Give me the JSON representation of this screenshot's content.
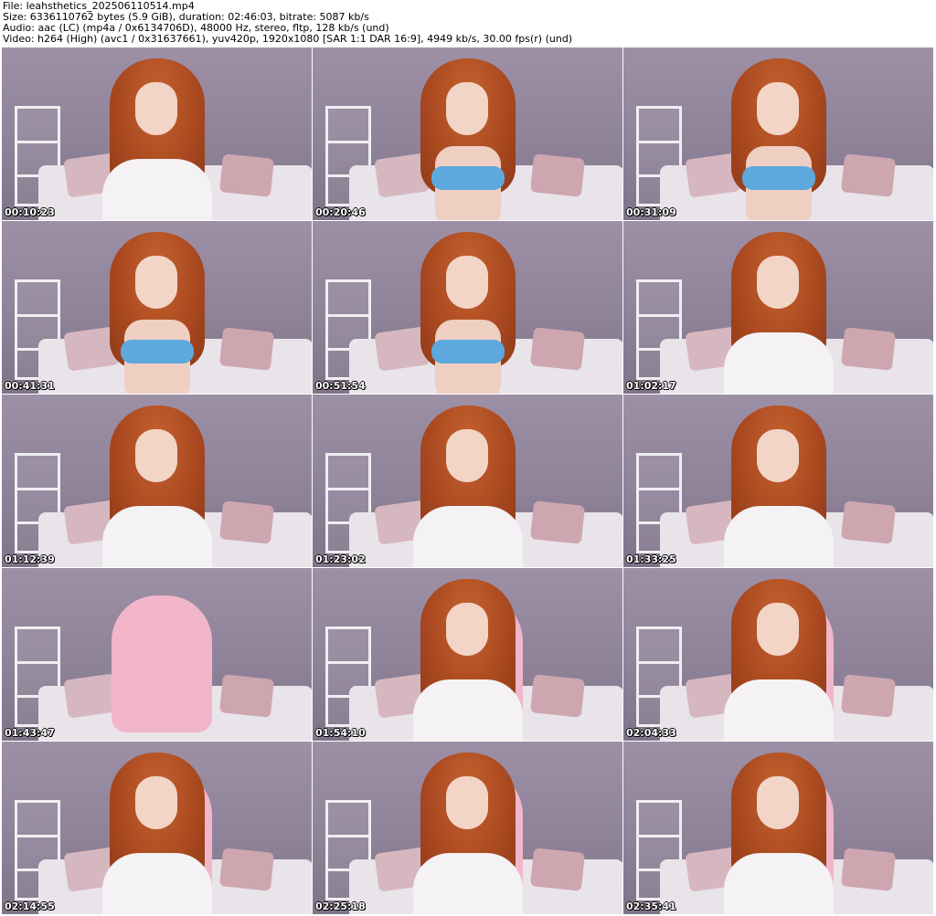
{
  "header": {
    "file_line": "File: leahsthetics_202506110514.mp4",
    "size_line": "Size: 6336110762 bytes (5.9 GiB), duration: 02:46:03, bitrate: 5087 kb/s",
    "audio_line": "Audio: aac (LC) (mp4a / 0x6134706D), 48000 Hz, stereo, fltp, 128 kb/s (und)",
    "video_line": "Video: h264 (High) (avc1 / 0x31637661), yuv420p, 1920x1080 [SAR 1:1 DAR 16:9], 4949 kb/s, 30.00 fps(r) (und)"
  },
  "thumbnails": [
    {
      "timestamp": "00:10:23",
      "variant": "white"
    },
    {
      "timestamp": "00:20:46",
      "variant": "blue"
    },
    {
      "timestamp": "00:31:09",
      "variant": "blue"
    },
    {
      "timestamp": "00:41:31",
      "variant": "blue"
    },
    {
      "timestamp": "00:51:54",
      "variant": "blue"
    },
    {
      "timestamp": "01:02:17",
      "variant": "white"
    },
    {
      "timestamp": "01:12:39",
      "variant": "white"
    },
    {
      "timestamp": "01:23:02",
      "variant": "white"
    },
    {
      "timestamp": "01:33:25",
      "variant": "white"
    },
    {
      "timestamp": "01:43:47",
      "variant": "chair"
    },
    {
      "timestamp": "01:54:10",
      "variant": "white"
    },
    {
      "timestamp": "02:04:33",
      "variant": "white"
    },
    {
      "timestamp": "02:14:55",
      "variant": "white"
    },
    {
      "timestamp": "02:25:18",
      "variant": "white"
    },
    {
      "timestamp": "02:35:41",
      "variant": "white"
    }
  ]
}
